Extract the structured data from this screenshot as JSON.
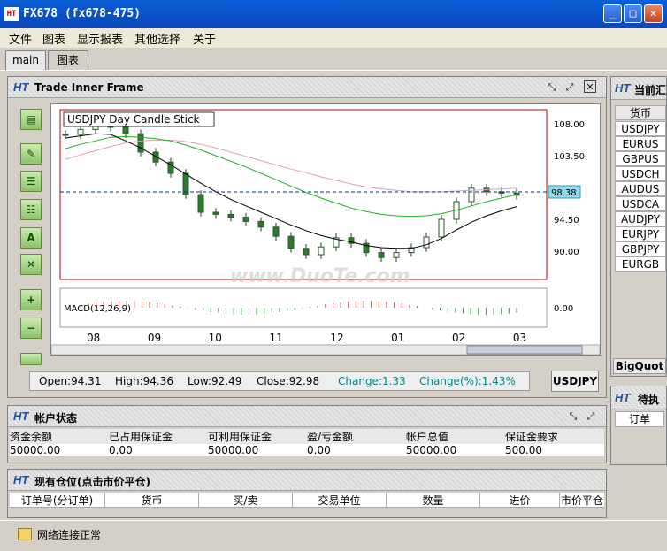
{
  "window": {
    "title": "FX678 (fx678-475)",
    "minimize": "_",
    "maximize": "□",
    "close": "✕"
  },
  "menu": [
    "文件",
    "图表",
    "显示报表",
    "其他选择",
    "关于"
  ],
  "tabs": [
    "main",
    "图表"
  ],
  "trade_frame": {
    "brand": "HT",
    "title": "Trade Inner Frame"
  },
  "chart_data": {
    "type": "line",
    "title": "USDJPY  Day  Candle Stick",
    "x": [
      "08",
      "09",
      "10",
      "11",
      "12",
      "01",
      "02",
      "03"
    ],
    "yticks": [
      "108.00",
      "103.50",
      "98.38",
      "94.50",
      "90.00"
    ],
    "current_value": "98.38",
    "close_series": [
      106.5,
      107.2,
      107.8,
      107.5,
      106.6,
      104.0,
      102.6,
      101.0,
      98.0,
      95.5,
      95.2,
      94.8,
      94.2,
      93.4,
      92.1,
      90.4,
      89.5,
      90.6,
      91.9,
      91.1,
      89.8,
      89.1,
      89.8,
      90.5,
      92.0,
      94.5,
      97.0,
      98.9,
      98.4,
      98.2,
      97.9
    ],
    "ma_black": [
      106.0,
      106.3,
      106.6,
      106.5,
      105.6,
      104.6,
      103.4,
      102.2,
      100.9,
      99.6,
      98.4,
      97.3,
      96.4,
      95.5,
      94.6,
      93.7,
      92.9,
      92.2,
      91.7,
      91.3,
      90.8,
      90.5,
      90.4,
      90.4,
      90.9,
      91.8,
      93.0,
      94.1,
      95.0,
      95.7,
      96.3
    ],
    "ma_green": [
      104.5,
      105.1,
      105.6,
      106.1,
      106.2,
      106.1,
      105.9,
      105.6,
      105.0,
      104.3,
      103.5,
      102.7,
      101.9,
      101.0,
      100.1,
      99.2,
      98.3,
      97.5,
      96.8,
      96.1,
      95.6,
      95.2,
      95.0,
      94.9,
      95.0,
      95.3,
      95.8,
      96.4,
      97.0,
      97.5,
      98.0
    ],
    "ma_pink": [
      103.0,
      103.6,
      104.2,
      104.8,
      105.3,
      105.6,
      105.7,
      105.7,
      105.5,
      105.1,
      104.6,
      104.0,
      103.4,
      102.8,
      102.2,
      101.6,
      101.1,
      100.5,
      100.0,
      99.5,
      99.1,
      98.8,
      98.6,
      98.4,
      98.4,
      98.4,
      98.5,
      98.6,
      98.7,
      98.8,
      98.9
    ],
    "macd_label": "MACD(12,26,9)",
    "macd_value": "0.00"
  },
  "status": {
    "open": "Open:94.31",
    "high": "High:94.36",
    "low": "Low:92.49",
    "close": "Close:92.98",
    "change": "Change:1.33",
    "change_pct": "Change(%):1.43%",
    "symbol": "USDJPY"
  },
  "account": {
    "title": "帐户状态",
    "headers": [
      "资金余额",
      "已占用保证金",
      "可利用保证金",
      "盈/亏金额",
      "帐户总值",
      "保证金要求"
    ],
    "values": [
      "50000.00",
      "0.00",
      "50000.00",
      "0.00",
      "50000.00",
      "500.00"
    ]
  },
  "positions": {
    "title": "现有仓位(点击市价平仓)",
    "headers": [
      "订单号(分订单)",
      "货币",
      "买/卖",
      "交易单位",
      "数量",
      "进价",
      "市价平仓"
    ]
  },
  "quotes": {
    "title": "当前汇",
    "header": "货币",
    "items": [
      "USDJPY",
      "EURUS",
      "GBPUS",
      "USDCH",
      "AUDUS",
      "USDCA",
      "AUDJPY",
      "EURJPY",
      "GBPJPY",
      "EURGB"
    ],
    "tab": "BigQuot"
  },
  "pending": {
    "title": "待执",
    "header": "订单"
  },
  "footer": {
    "network": "网络连接正常"
  },
  "watermark": "www.DuoTe.com"
}
